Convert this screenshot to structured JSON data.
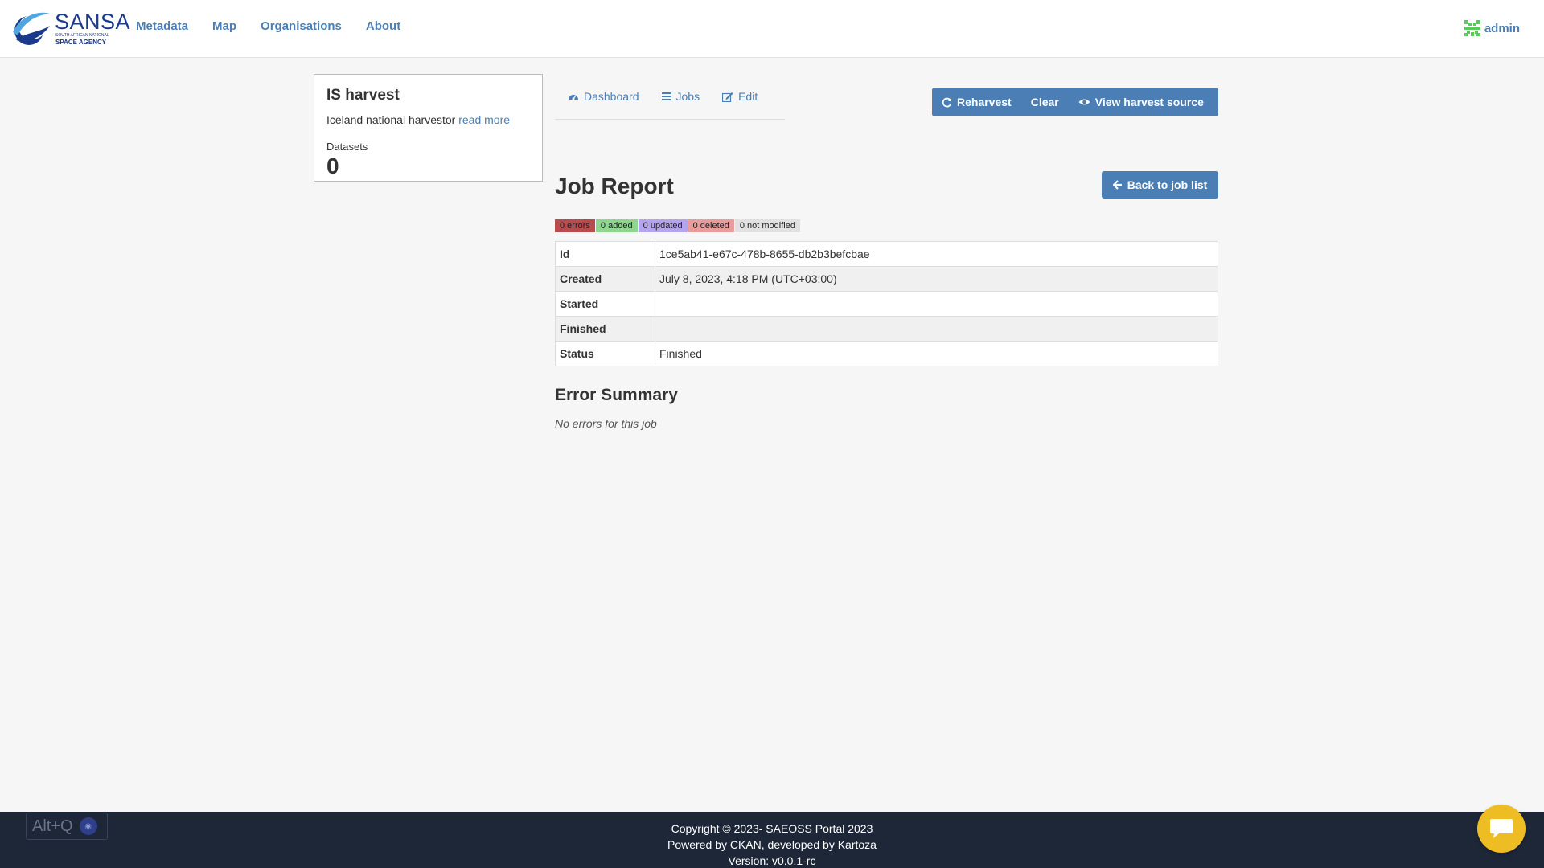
{
  "header": {
    "logo": {
      "name": "SANSA",
      "sub_line1": "SOUTH AFRICAN NATIONAL",
      "sub_line2": "SPACE AGENCY"
    },
    "nav": [
      {
        "label": "Metadata"
      },
      {
        "label": "Map"
      },
      {
        "label": "Organisations"
      },
      {
        "label": "About"
      }
    ],
    "user": {
      "name": "admin",
      "avatar_icon": "identicon"
    }
  },
  "source_card": {
    "title": "IS harvest",
    "description": "Iceland national harvestor",
    "read_more": "read more",
    "datasets_label": "Datasets",
    "datasets_count": "0"
  },
  "tabs": [
    {
      "label": "Dashboard",
      "icon": "dashboard-icon"
    },
    {
      "label": "Jobs",
      "icon": "list-icon"
    },
    {
      "label": "Edit",
      "icon": "edit-icon"
    }
  ],
  "actions": {
    "reharvest": "Reharvest",
    "clear": "Clear",
    "view_source": "View harvest source"
  },
  "report": {
    "title": "Job Report",
    "back_label": "Back to job list",
    "badges": {
      "errors": "0 errors",
      "added": "0 added",
      "updated": "0 updated",
      "deleted": "0 deleted",
      "not_modified": "0 not modified"
    },
    "rows": [
      {
        "key": "Id",
        "value": "1ce5ab41-e67c-478b-8655-db2b3befcbae"
      },
      {
        "key": "Created",
        "value": "July 8, 2023, 4:18 PM (UTC+03:00)"
      },
      {
        "key": "Started",
        "value": ""
      },
      {
        "key": "Finished",
        "value": ""
      },
      {
        "key": "Status",
        "value": "Finished"
      }
    ],
    "error_title": "Error Summary",
    "error_message": "No errors for this job"
  },
  "footer": {
    "copyright": "Copyright © 2023- SAEOSS Portal 2023",
    "powered": "Powered by CKAN, developed by Kartoza",
    "version": "Version: v0.0.1-rc"
  },
  "widgets": {
    "shortcut": "Alt+Q",
    "chat_icon": "chat-bubble-icon"
  },
  "colors": {
    "link": "#4a7eb5",
    "primary_button": "#4a7eb5",
    "footer_bg": "#1d2738",
    "chat_button": "#eebd24"
  }
}
